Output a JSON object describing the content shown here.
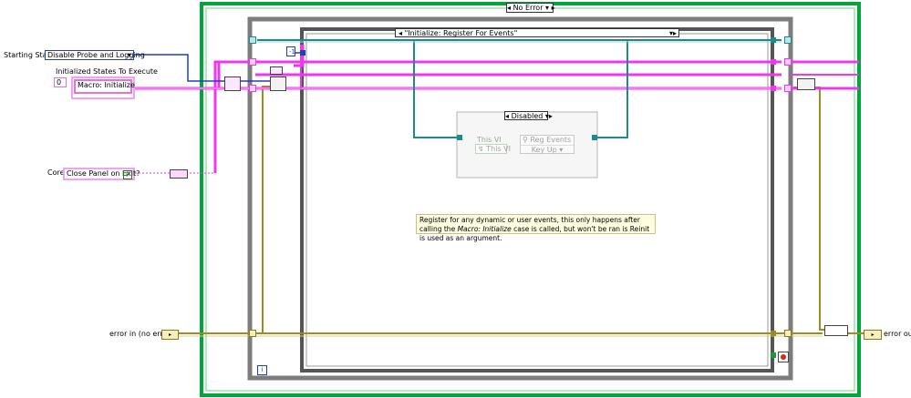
{
  "outer_case": {
    "selector": "No Error"
  },
  "inner_case": {
    "selector": "\"Initialize: Register For Events\""
  },
  "disabled_structure": {
    "selector": "Disabled",
    "this_vi_label": "This VI",
    "this_vi_ref": "This VI",
    "reg_events_title": "Reg Events",
    "reg_events_item": "Key Up"
  },
  "controls": {
    "starting_state": {
      "label": "Starting State",
      "value": "Disable Probe and Logging"
    },
    "initialized_states": {
      "label": "Initialized States To Execute",
      "index": "0",
      "value": "Macro: Initialize"
    },
    "core": {
      "label": "Core",
      "value": "Close Panel on Exit?",
      "bool": "F"
    },
    "error_in": {
      "label": "error in (no error)"
    },
    "error_out": {
      "label": "error out"
    }
  },
  "constants": {
    "minus_one": "-1",
    "loop_index": "i"
  },
  "comment": {
    "before": "Register for any dynamic or user events, this only happens after calling the ",
    "italic1": "Macro: Initialize",
    "after": " case is called, but won't be ran is Reinit is used as an argument."
  },
  "colors": {
    "string_wire": "#ee38ee",
    "enum_wire": "#1f3fbf",
    "error_wire": "#a08c1e",
    "ref_wire": "#1e8a8a",
    "case_frame": "#00a63a",
    "loop_frame": "#7d7d7d"
  }
}
